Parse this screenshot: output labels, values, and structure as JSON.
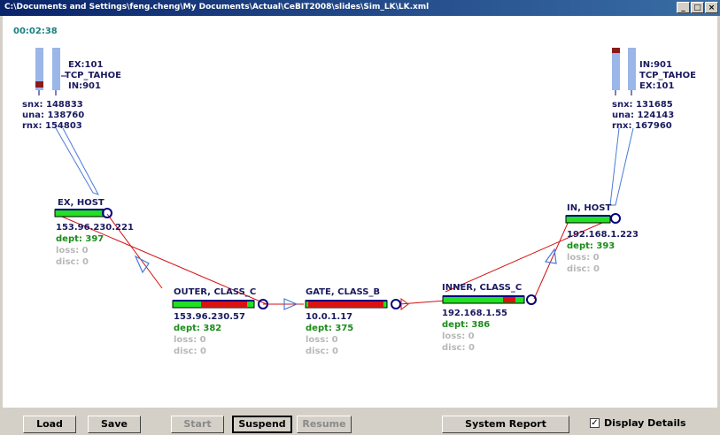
{
  "window": {
    "title": "C:\\Documents and Settings\\feng.cheng\\My Documents\\Actual\\CeBIT2008\\slides\\Sim_LK\\LK.xml",
    "minimize_glyph": "_",
    "maximize_glyph": "□",
    "close_glyph": "×"
  },
  "timer": "00:02:38",
  "left_endpoint": {
    "ex": "EX:101",
    "algo": "TCP_TAHOE",
    "in": "IN:901",
    "snx": "snx: 148833",
    "una": "una: 138760",
    "rnx": "rnx: 154803"
  },
  "right_endpoint": {
    "in": "IN:901",
    "algo": "TCP_TAHOE",
    "ex": "EX:101",
    "snx": "snx: 131685",
    "una": "una: 124143",
    "rnx": "rnx: 167960"
  },
  "nodes": {
    "ex_host": {
      "name": "EX, HOST",
      "ip": "153.96.230.221",
      "dept": "dept: 397",
      "loss": "loss: 0",
      "disc": "disc: 0"
    },
    "outer": {
      "name": "OUTER, CLASS_C",
      "ip": "153.96.230.57",
      "dept": "dept: 382",
      "loss": "loss: 0",
      "disc": "disc: 0"
    },
    "gate": {
      "name": "GATE, CLASS_B",
      "ip": "10.0.1.17",
      "dept": "dept: 375",
      "loss": "loss: 0",
      "disc": "disc: 0"
    },
    "inner": {
      "name": "INNER, CLASS_C",
      "ip": "192.168.1.55",
      "dept": "dept: 386",
      "loss": "loss: 0",
      "disc": "disc: 0"
    },
    "in_host": {
      "name": "IN, HOST",
      "ip": "192.168.1.223",
      "dept": "dept: 393",
      "loss": "loss: 0",
      "disc": "disc: 0"
    }
  },
  "toolbar": {
    "load": "Load",
    "save": "Save",
    "start": "Start",
    "suspend": "Suspend",
    "resume": "Resume",
    "system_report": "System Report",
    "display_details": "Display Details",
    "display_details_checked": true
  },
  "colors": {
    "queue_green": "#22e022",
    "queue_red": "#e01010",
    "link_red": "#d01010",
    "link_blue": "#4a7ad8",
    "node_navy": "#000080",
    "buffer_blue": "#9bb6e8",
    "buffer_dark": "#8b1a1a"
  }
}
